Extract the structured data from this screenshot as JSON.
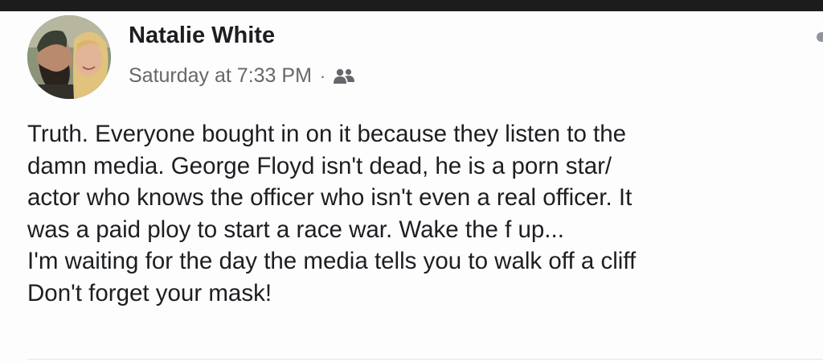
{
  "post": {
    "author_name": "Natalie White",
    "timestamp": "Saturday at 7:33 PM",
    "separator": "·",
    "audience_icon": "friends-icon",
    "body_lines": [
      "Truth. Everyone bought in on it because they listen to the",
      "damn media.  George Floyd isn't dead, he is a porn star/",
      "actor who knows the officer who isn't even a real officer. It",
      "was a paid ploy to start a race war.  Wake the f up...",
      "I'm waiting for the day the media tells you to walk off a cliff",
      "Don't forget your mask!"
    ]
  },
  "colors": {
    "text_primary": "#1c1e21",
    "text_secondary": "#65676b",
    "top_bar": "#1c1c1c"
  }
}
